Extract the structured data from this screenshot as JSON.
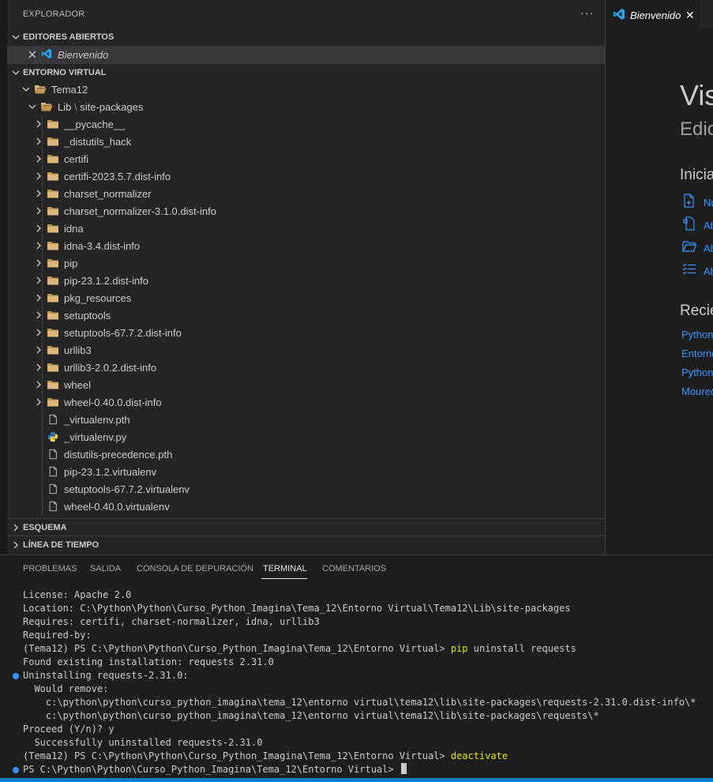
{
  "explorer": {
    "title": "EXPLORADOR",
    "more": "···"
  },
  "open_editors": {
    "header": "EDITORES ABIERTOS",
    "items": [
      {
        "label": "Bienvenido"
      }
    ]
  },
  "workspace": {
    "header": "ENTORNO VIRTUAL",
    "root_folder": "Tema12",
    "subfolder": "Lib",
    "subfolder_sep": "\\",
    "subfolder_child": "site-packages",
    "folders": [
      "__pycache__",
      "_distutils_hack",
      "certifi",
      "certifi-2023.5.7.dist-info",
      "charset_normalizer",
      "charset_normalizer-3.1.0.dist-info",
      "idna",
      "idna-3.4.dist-info",
      "pip",
      "pip-23.1.2.dist-info",
      "pkg_resources",
      "setuptools",
      "setuptools-67.7.2.dist-info",
      "urllib3",
      "urllib3-2.0.2.dist-info",
      "wheel",
      "wheel-0.40.0.dist-info"
    ],
    "files": [
      {
        "name": "_virtualenv.pth",
        "icon": "file-icon"
      },
      {
        "name": "_virtualenv.py",
        "icon": "python-icon"
      },
      {
        "name": "distutils-precedence.pth",
        "icon": "file-icon"
      },
      {
        "name": "pip-23.1.2.virtualenv",
        "icon": "file-icon"
      },
      {
        "name": "setuptools-67.7.2.virtualenv",
        "icon": "file-icon"
      },
      {
        "name": "wheel-0.40.0.virtualenv",
        "icon": "file-icon"
      }
    ]
  },
  "outline": {
    "header": "ESQUEMA"
  },
  "timeline": {
    "header": "LÍNEA DE TIEMPO"
  },
  "editor": {
    "tab_label": "Bienvenido",
    "welcome_title": "Vis",
    "welcome_subtitle": "Edic",
    "start_heading": "Inicia",
    "start_links": [
      "Nu",
      "Ab",
      "Ab",
      "Ab"
    ],
    "recent_heading": "Recie",
    "recent_links": [
      "Python",
      "Entorno",
      "Python",
      "Moured"
    ]
  },
  "panel": {
    "tabs": [
      "PROBLEMAS",
      "SALIDA",
      "CONSOLA DE DEPURACIÓN",
      "TERMINAL",
      "COMENTARIOS"
    ],
    "active_tab": "TERMINAL"
  },
  "terminal": {
    "lines": [
      {
        "text": "License: Apache 2.0",
        "dot": false
      },
      {
        "text": "Location: C:\\Python\\Python\\Curso_Python_Imagina\\Tema_12\\Entorno Virtual\\Tema12\\Lib\\site-packages",
        "dot": false
      },
      {
        "text": "Requires: certifi, charset-normalizer, idna, urllib3",
        "dot": false
      },
      {
        "text": "Required-by:",
        "dot": false
      },
      {
        "text": "(Tema12) PS C:\\Python\\Python\\Curso_Python_Imagina\\Tema_12\\Entorno Virtual> ",
        "cmd": "pip",
        "rest": " uninstall requests",
        "dot": false
      },
      {
        "text": "Found existing installation: requests 2.31.0",
        "dot": false
      },
      {
        "text": "Uninstalling requests-2.31.0:",
        "dot": true
      },
      {
        "text": "  Would remove:",
        "dot": false
      },
      {
        "text": "    c:\\python\\python\\curso_python_imagina\\tema_12\\entorno virtual\\tema12\\lib\\site-packages\\requests-2.31.0.dist-info\\*",
        "dot": false
      },
      {
        "text": "    c:\\python\\python\\curso_python_imagina\\tema_12\\entorno virtual\\tema12\\lib\\site-packages\\requests\\*",
        "dot": false
      },
      {
        "text": "Proceed (Y/n)? y",
        "dot": false
      },
      {
        "text": "  Successfully uninstalled requests-2.31.0",
        "dot": false
      },
      {
        "text": "(Tema12) PS C:\\Python\\Python\\Curso_Python_Imagina\\Tema_12\\Entorno Virtual> ",
        "cmd": "deactivate",
        "rest": "",
        "dot": false
      },
      {
        "text": "PS C:\\Python\\Python\\Curso_Python_Imagina\\Tema_12\\Entorno Virtual>",
        "dot": true,
        "cursor": true
      }
    ]
  },
  "colors": {
    "accent": "#007acc",
    "link": "#3794ff",
    "folder": "#dcb67a",
    "command": "#e5e510"
  }
}
